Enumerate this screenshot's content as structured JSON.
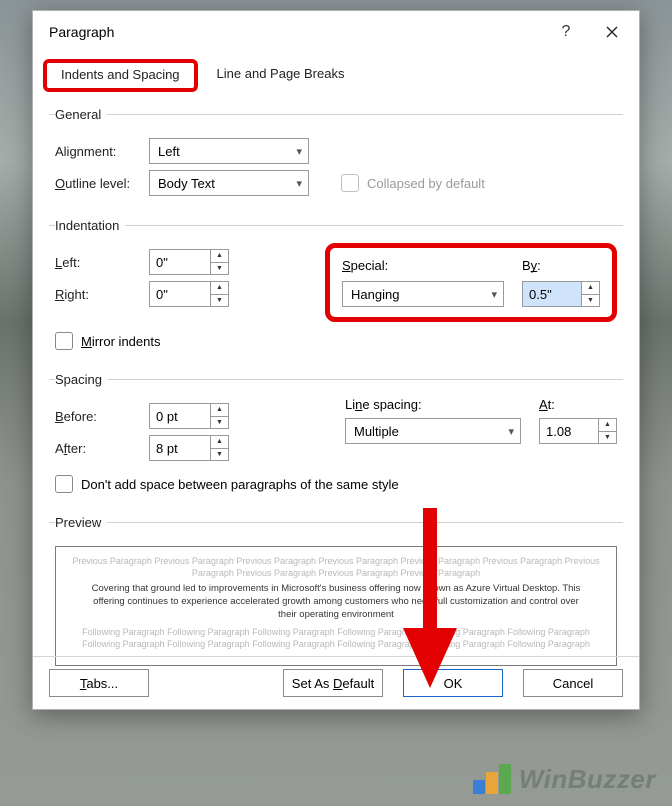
{
  "dialog": {
    "title": "Paragraph",
    "help": "?",
    "tabs": {
      "indents": "Indents and Spacing",
      "breaks": "Line and Page Breaks"
    }
  },
  "general": {
    "legend": "General",
    "alignment_label": "Alignment:",
    "alignment_value": "Left",
    "outline_label": "Outline level:",
    "outline_value": "Body Text",
    "collapsed_label": "Collapsed by default"
  },
  "indentation": {
    "legend": "Indentation",
    "left_label": "Left:",
    "left_value": "0\"",
    "right_label": "Right:",
    "right_value": "0\"",
    "special_label": "Special:",
    "special_value": "Hanging",
    "by_label": "By:",
    "by_value": "0.5\"",
    "mirror_label": "Mirror indents"
  },
  "spacing": {
    "legend": "Spacing",
    "before_label": "Before:",
    "before_value": "0 pt",
    "after_label": "After:",
    "after_value": "8 pt",
    "line_label": "Line spacing:",
    "line_value": "Multiple",
    "at_label": "At:",
    "at_value": "1.08",
    "dontadd_label": "Don't add space between paragraphs of the same style"
  },
  "preview": {
    "legend": "Preview",
    "prev_text": "Previous Paragraph Previous Paragraph Previous Paragraph Previous Paragraph Previous Paragraph Previous Paragraph Previous Paragraph Previous Paragraph Previous Paragraph Previous Paragraph",
    "current_text": "Covering that ground led to improvements in Microsoft's business offering now known as Azure Virtual Desktop. This offering continues to experience accelerated growth among customers who need full customization and control over their operating environment",
    "follow_text": "Following Paragraph Following Paragraph Following Paragraph Following Paragraph Following Paragraph Following Paragraph Following Paragraph Following Paragraph Following Paragraph Following Paragraph Following Paragraph Following Paragraph"
  },
  "buttons": {
    "tabs": "Tabs...",
    "default": "Set As Default",
    "ok": "OK",
    "cancel": "Cancel"
  },
  "watermark": {
    "text": "WinBuzzer"
  }
}
